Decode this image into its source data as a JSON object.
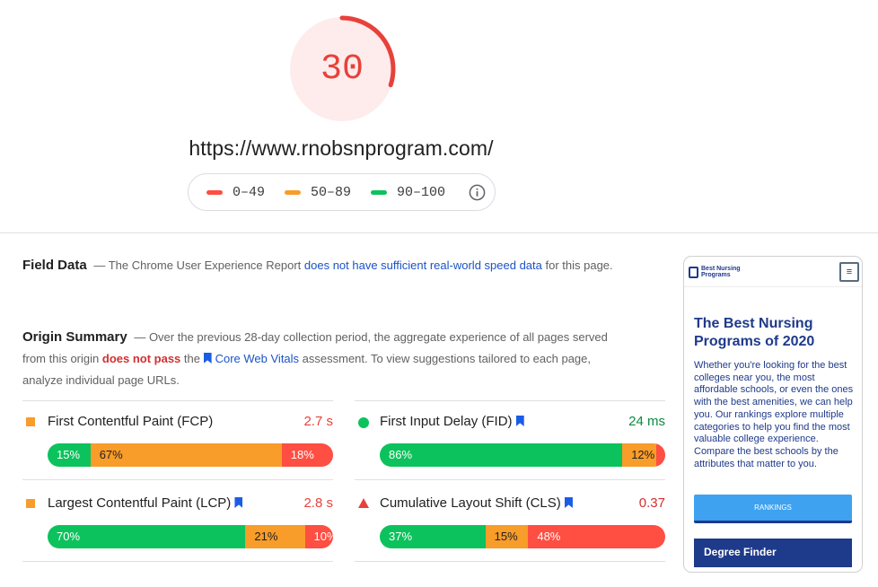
{
  "score": {
    "value": "30",
    "fraction": 0.3,
    "color": "#e8413b"
  },
  "url": "https://www.rnobsnprogram.com/",
  "legend": [
    {
      "label": "0–49",
      "color": "#ff4e42"
    },
    {
      "label": "50–89",
      "color": "#f89c2a"
    },
    {
      "label": "90–100",
      "color": "#0cc25c"
    }
  ],
  "field_data": {
    "title": "Field Data",
    "text_before": "— The Chrome User Experience Report ",
    "link": "does not have sufficient real-world speed data",
    "text_after": " for this page."
  },
  "origin_summary": {
    "title": "Origin Summary",
    "text_before": "— Over the previous 28-day collection period, the aggregate experience of all pages served from this origin ",
    "status": "does not pass",
    "text_mid": " the ",
    "link": "Core Web Vitals",
    "text_after": " assessment. To view suggestions tailored to each page, analyze individual page URLs."
  },
  "metrics": [
    {
      "name": "First Contentful Paint (FCP)",
      "value": "2.7 s",
      "value_color": "#e8413b",
      "icon": "orange-square-icon",
      "bookmark": false,
      "good": 15,
      "avg": 67,
      "poor": 18,
      "good_label": "15%",
      "avg_label": "67%",
      "poor_label": "18%"
    },
    {
      "name": "First Input Delay (FID)",
      "value": "24 ms",
      "value_color": "#0c8a3e",
      "icon": "green-circle-icon",
      "bookmark": true,
      "good": 86,
      "avg": 12,
      "poor": 2,
      "good_label": "86%",
      "avg_label": "12%",
      "poor_label": "2%"
    },
    {
      "name": "Largest Contentful Paint (LCP)",
      "value": "2.8 s",
      "value_color": "#e8413b",
      "icon": "orange-square-icon",
      "bookmark": true,
      "good": 70,
      "avg": 21,
      "poor": 10,
      "good_label": "70%",
      "avg_label": "21%",
      "poor_label": "10%"
    },
    {
      "name": "Cumulative Layout Shift (CLS)",
      "value": "0.37",
      "value_color": "#d32f2f",
      "icon": "red-triangle-icon",
      "bookmark": true,
      "good": 37,
      "avg": 15,
      "poor": 48,
      "good_label": "37%",
      "avg_label": "15%",
      "poor_label": "48%"
    }
  ],
  "phone": {
    "logo_line1": "Best Nursing",
    "logo_line2": "Programs",
    "menu_icon": "≡",
    "hero": "The Best Nursing Programs of 2020",
    "body": "Whether you're looking for the best colleges near you, the most affordable schools, or even the ones with the best amenities, we can help you. Our rankings explore multiple categories to help you find the most valuable college experience. Compare the best schools by the attributes that matter to you.",
    "button": "RANKINGS",
    "finder": "Degree Finder"
  }
}
